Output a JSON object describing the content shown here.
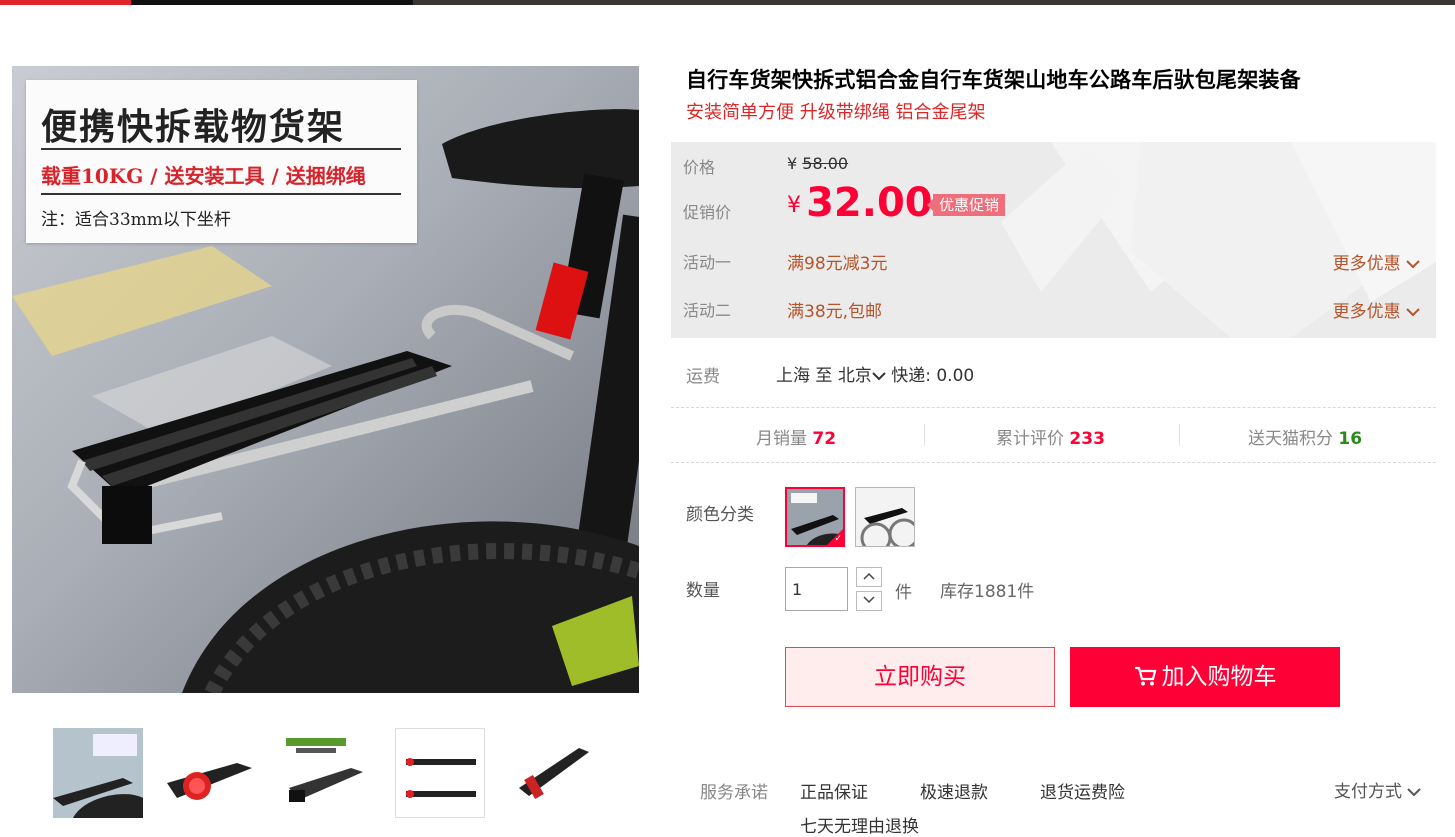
{
  "main_image": {
    "promo_title": "便携快拆载物货架",
    "promo_sub": "载重10KG / 送安装工具 / 送捆绑绳",
    "promo_note": "注：适合33mm以下坐杆"
  },
  "product": {
    "title": "自行车货架快拆式铝合金自行车货架山地车公路车后驮包尾架装备",
    "subtitle": "安装简单方便 升级带绑绳 铝合金尾架"
  },
  "price": {
    "price_label": "价格",
    "currency": "¥",
    "original_price": "58.00",
    "promo_label": "促销价",
    "promo_price": "32.00",
    "promo_badge": "优惠促销",
    "activities": [
      {
        "label": "活动一",
        "text": "满98元减3元",
        "more": "更多优惠"
      },
      {
        "label": "活动二",
        "text": "满38元,包邮",
        "more": "更多优惠"
      }
    ]
  },
  "shipping": {
    "label": "运费",
    "from": "上海",
    "to_word": "至",
    "to": "北京",
    "express": "快递: 0.00"
  },
  "stats": {
    "monthly_sales_label": "月销量",
    "monthly_sales": "72",
    "reviews_label": "累计评价",
    "reviews": "233",
    "points_label": "送天猫积分",
    "points": "16"
  },
  "options": {
    "color_label": "颜色分类",
    "quantity_label": "数量",
    "quantity": "1",
    "unit": "件",
    "stock": "库存1881件"
  },
  "actions": {
    "buy_now": "立即购买",
    "add_to_cart": "加入购物车"
  },
  "service": {
    "label": "服务承诺",
    "items": [
      "正品保证",
      "极速退款",
      "退货运费险",
      "七天无理由退换"
    ],
    "payment": "支付方式"
  },
  "icons": {
    "cart": "cart-icon",
    "chevron": "chevron-down-icon",
    "check": "check-icon"
  },
  "colors": {
    "accent": "#ff0036",
    "activity": "#b5532a",
    "badge": "#ee6e7c"
  }
}
